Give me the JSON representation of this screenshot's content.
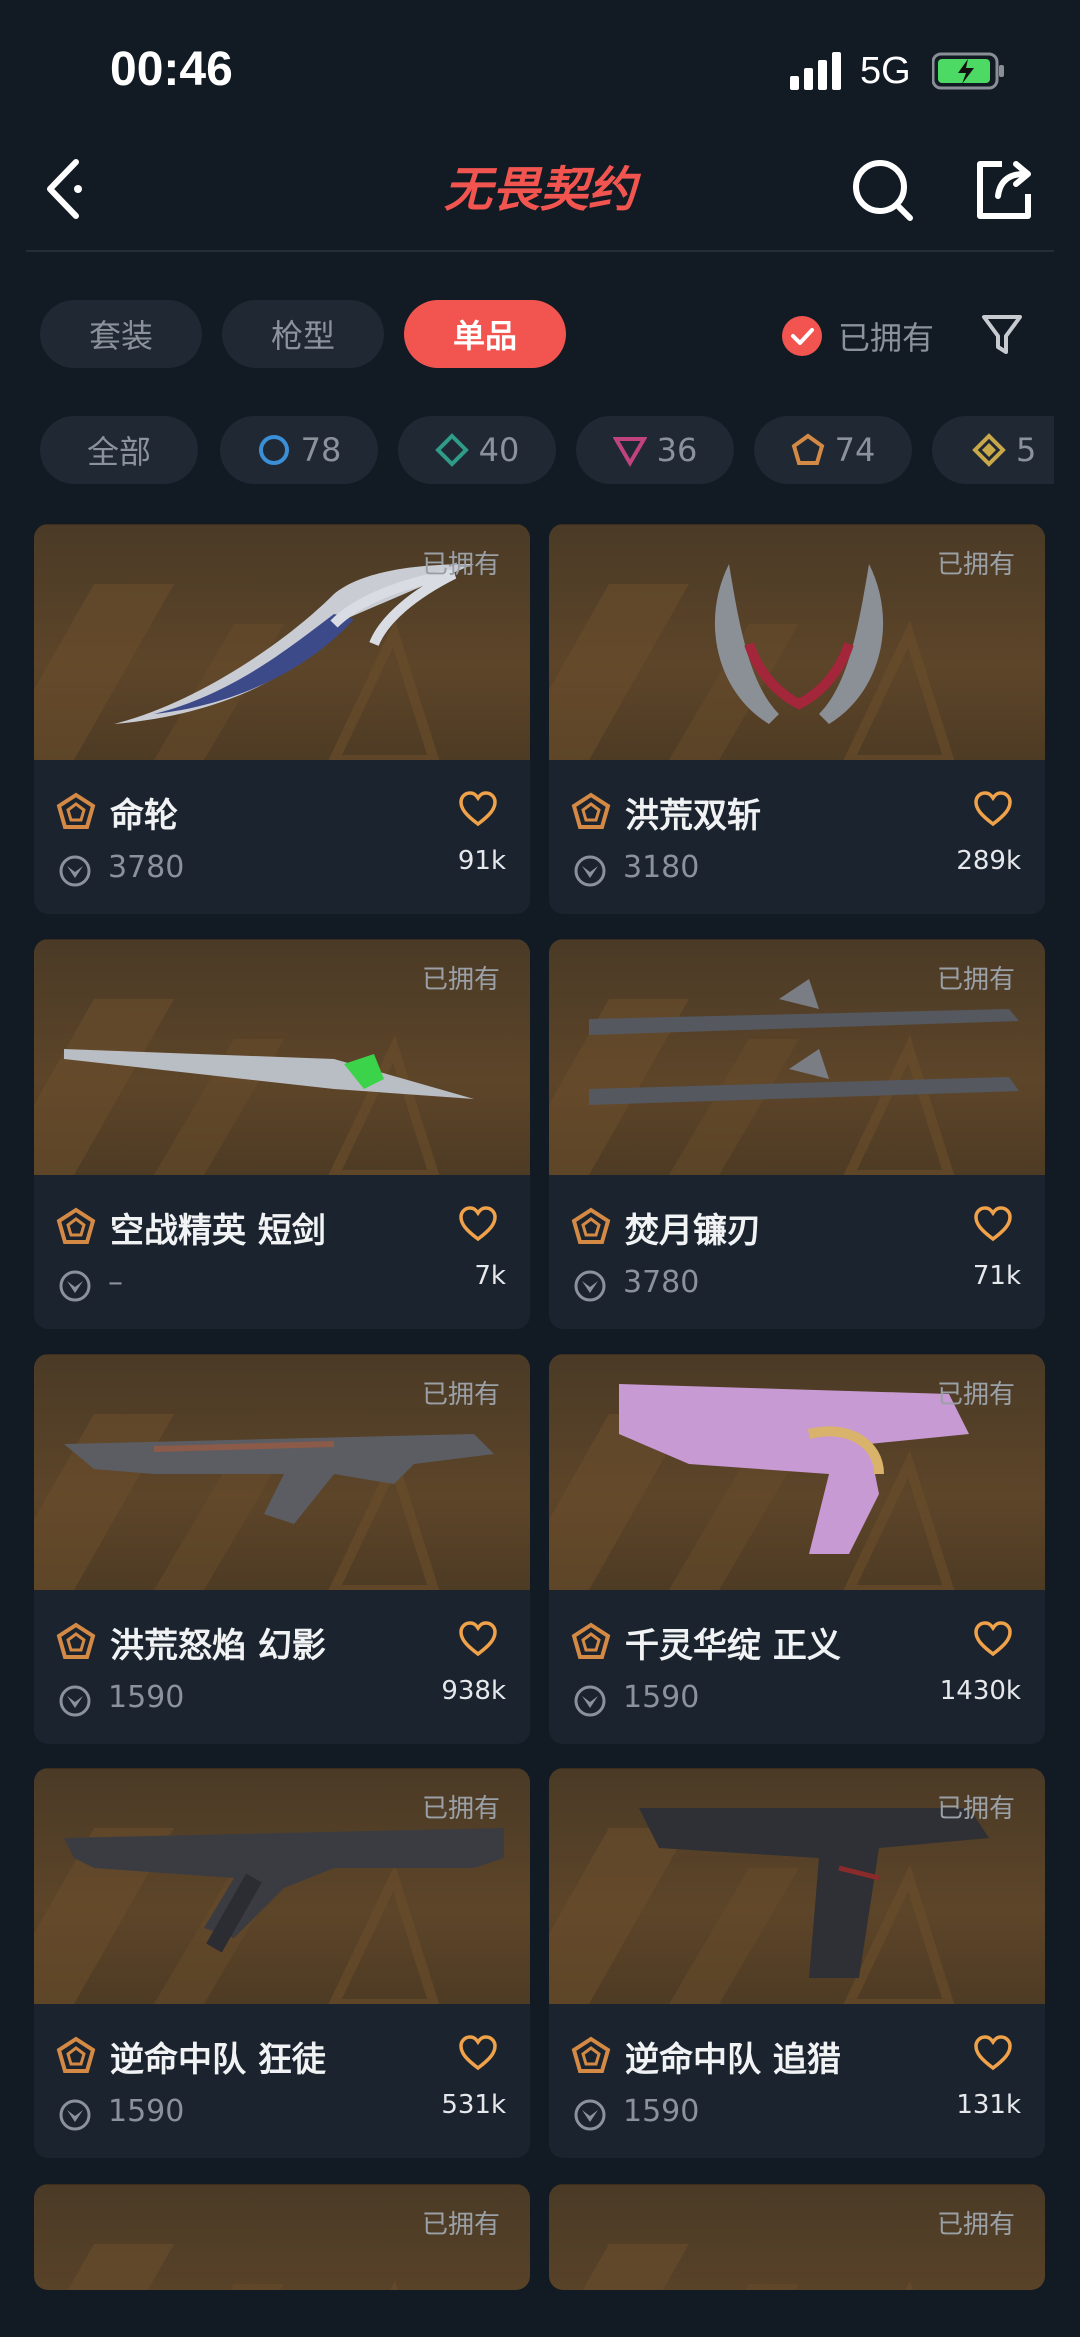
{
  "status_bar": {
    "time": "00:46",
    "network": "5G"
  },
  "header": {
    "logo_text": "无畏契约"
  },
  "tabs": [
    {
      "label": "套装"
    },
    {
      "label": "枪型"
    },
    {
      "label": "单品"
    }
  ],
  "active_tab": "单品",
  "owned_filter": {
    "label": "已拥有",
    "checked": true
  },
  "rarity_chips": [
    {
      "label": "全部"
    },
    {
      "label": "78",
      "icon": "select-tier-icon",
      "color": "#3b8fd6"
    },
    {
      "label": "40",
      "icon": "deluxe-tier-icon",
      "color": "#2e9c86"
    },
    {
      "label": "36",
      "icon": "premium-tier-icon",
      "color": "#c0437f"
    },
    {
      "label": "74",
      "icon": "exclusive-tier-icon",
      "color": "#d48a45"
    },
    {
      "label": "5",
      "icon": "ultra-tier-icon",
      "color": "#c9a84a"
    }
  ],
  "cards": [
    {
      "name": "命轮",
      "price": "3780",
      "likes": "91k",
      "owned_tag": "已拥有"
    },
    {
      "name": "洪荒双斩",
      "price": "3180",
      "likes": "289k",
      "owned_tag": "已拥有"
    },
    {
      "name": "空战精英 短剑",
      "price": "–",
      "likes": "7k",
      "owned_tag": "已拥有"
    },
    {
      "name": "焚月镰刃",
      "price": "3780",
      "likes": "71k",
      "owned_tag": "已拥有"
    },
    {
      "name": "洪荒怒焰 幻影",
      "price": "1590",
      "likes": "938k",
      "owned_tag": "已拥有"
    },
    {
      "name": "千灵华绽 正义",
      "price": "1590",
      "likes": "1430k",
      "owned_tag": "已拥有"
    },
    {
      "name": "逆命中队 狂徒",
      "price": "1590",
      "likes": "531k",
      "owned_tag": "已拥有"
    },
    {
      "name": "逆命中队 追猎",
      "price": "1590",
      "likes": "131k",
      "owned_tag": "已拥有"
    },
    {
      "name": "",
      "price": "",
      "likes": "",
      "owned_tag": "已拥有"
    },
    {
      "name": "",
      "price": "",
      "likes": "",
      "owned_tag": "已拥有"
    }
  ],
  "colors": {
    "accent": "#f2554f",
    "background": "#121a24",
    "card": "#1b232e",
    "rank_orange": "#d48a45"
  }
}
